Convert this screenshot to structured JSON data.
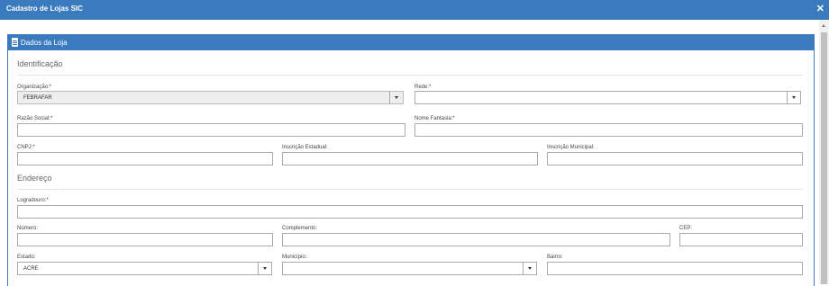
{
  "window": {
    "title": "Cadastro de Lojas SIC",
    "close_symbol": "✕"
  },
  "panel": {
    "title": "Dados da Loja"
  },
  "sections": {
    "identificacao": "Identificação",
    "endereco": "Endereço"
  },
  "fields": {
    "organizacao": {
      "label": "Organização:*",
      "value": "FEBRAFAR"
    },
    "rede": {
      "label": "Rede:*",
      "value": ""
    },
    "razao_social": {
      "label": "Razão Social:*",
      "value": ""
    },
    "nome_fantasia": {
      "label": "Nome Fantasia:*",
      "value": ""
    },
    "cnpj": {
      "label": "CNPJ:*",
      "value": ""
    },
    "inscricao_estadual": {
      "label": "Inscrição Estadual:",
      "value": ""
    },
    "inscricao_municipal": {
      "label": "Inscrição Municipal:",
      "value": ""
    },
    "logradouro": {
      "label": "Logradouro:*",
      "value": ""
    },
    "numero": {
      "label": "Número:",
      "value": ""
    },
    "complemento": {
      "label": "Complemento:",
      "value": ""
    },
    "cep": {
      "label": "CEP:",
      "value": ""
    },
    "estado": {
      "label": "Estado:",
      "value": "ACRE"
    },
    "municipio": {
      "label": "Município:",
      "value": ""
    },
    "bairro": {
      "label": "Bairro:",
      "value": ""
    }
  }
}
